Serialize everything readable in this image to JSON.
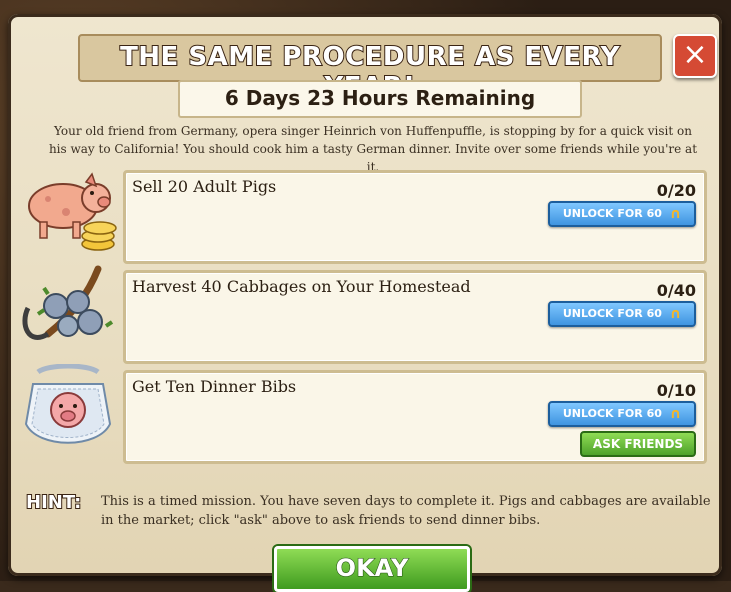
{
  "dialog": {
    "title": "THE SAME PROCEDURE AS EVERY YEAR!",
    "timer": "6 Days 23 Hours Remaining",
    "intro": "Your old friend from Germany, opera singer Heinrich von Huffenpuffle, is stopping by for a quick visit on his way to California! You should cook him a tasty German dinner. Invite over some friends while you're at it.",
    "close_icon": "×"
  },
  "tasks": [
    {
      "label": "Sell 20 Adult Pigs",
      "count": "0/20",
      "unlock": "UNLOCK FOR 60",
      "icon": "pig-with-coins-icon"
    },
    {
      "label": "Harvest 40 Cabbages on Your Homestead",
      "count": "0/40",
      "unlock": "UNLOCK FOR 60",
      "icon": "cabbage-scythe-icon"
    },
    {
      "label": "Get Ten Dinner Bibs",
      "count": "0/10",
      "unlock": "UNLOCK FOR 60",
      "ask": "ASK FRIENDS",
      "icon": "dinner-bib-icon"
    }
  ],
  "hint": {
    "label": "HINT:",
    "text": "This is a timed mission. You have seven days to complete it. Pigs and cabbages are available in the market; click \"ask\" above to ask friends to send dinner bibs."
  },
  "okay_label": "OKAY",
  "horseshoe_icon": "horseshoe-icon"
}
